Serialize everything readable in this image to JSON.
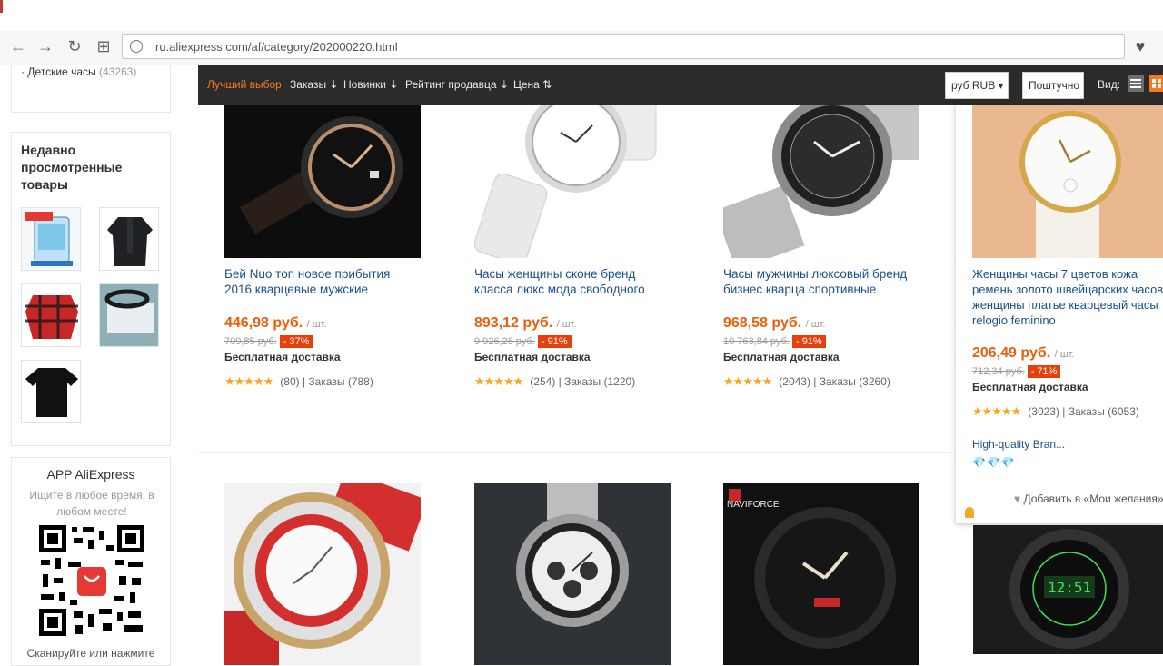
{
  "browser": {
    "url": "ru.aliexpress.com/af/category/202000220.html",
    "back": "←",
    "forward": "→",
    "reload": "↻",
    "apps": "⊞",
    "heart": "♥"
  },
  "sidebar": {
    "kids_label": "Детские часы",
    "kids_count": "(43263)",
    "recent_title": "Недавно просмотренные товары",
    "app_title": "APP AliExpress",
    "app_sub": "Ищите в любое время, в любом месте!",
    "app_cut": "Сканируйте или нажмите"
  },
  "filter": {
    "items": [
      "Лучший выбор",
      "Заказы ⇣",
      "Новинки ⇣",
      "Рейтинг продавца ⇣",
      "Цена ⇅"
    ],
    "currency": "руб RUB ▾",
    "unit": "Поштучно",
    "view_label": "Вид:"
  },
  "products": [
    {
      "name": "Бей Nuo топ новое прибытия 2016 кварцевые мужские",
      "price": "446,98 руб.",
      "unit": "/ шт.",
      "old": "709,85 руб.",
      "disc": "- 37%",
      "ship": "Бесплатная доставка",
      "stars": "★★★★★",
      "meta": "(80)  |  Заказы (788)"
    },
    {
      "name": "Часы женщины сконе бренд класса люкс мода свободного",
      "price": "893,12 руб.",
      "unit": "/ шт.",
      "old": "9 926,28 руб.",
      "disc": "- 91%",
      "ship": "Бесплатная доставка",
      "stars": "★★★★★",
      "meta": "(254)  |  Заказы (1220)"
    },
    {
      "name": "Часы мужчины люксовый бренд бизнес кварца спортивные",
      "price": "968,58 руб.",
      "unit": "/ шт.",
      "old": "10 763,84 руб.",
      "disc": "- 91%",
      "ship": "Бесплатная доставка",
      "stars": "★★★★★",
      "meta": "(2043)  |  Заказы (3260)"
    },
    {
      "name": "Женщины часы 7 цветов кожа ремень золото швейцарских часов женщины платье кварцевый часы relogio feminino",
      "price": "206,49 руб.",
      "unit": "/ шт.",
      "old": "712,34 руб.",
      "disc": "- 71%",
      "ship": "Бесплатная доставка",
      "stars": "★★★★★",
      "meta": "(3023)  |  Заказы (6053)"
    }
  ],
  "popup": {
    "brand": "High-quality Bran...",
    "gems": "💎💎💎",
    "wish": "Добавить в «Мои желания»"
  },
  "row2": {
    "naviforce": "NAVIFORCE"
  },
  "colors": {
    "accent": "#f47920",
    "price": "#e8600c",
    "link": "#1a4f8b",
    "bar": "#2b2b2b"
  }
}
